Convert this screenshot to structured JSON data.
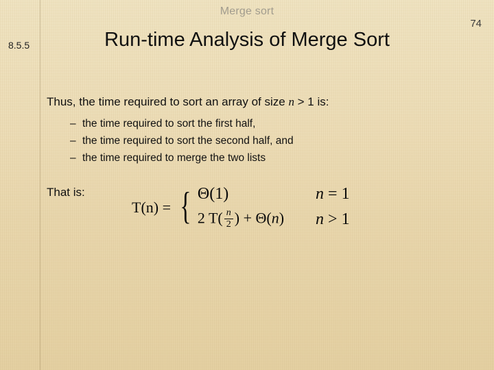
{
  "header": {
    "topic": "Merge sort"
  },
  "page_number": "74",
  "section_number": "8.5.5",
  "title": "Run-time Analysis of Merge Sort",
  "body": {
    "intro_pre": "Thus, the time required to sort an array of size ",
    "intro_var": "n",
    "intro_post": " > 1 is:",
    "bullets": [
      "the time required to sort the first half,",
      "the time required to sort the second half, and",
      "the time required to merge the two lists"
    ],
    "that_is": "That is:"
  },
  "formula": {
    "lhs": "T(n) =",
    "case1_expr": "Θ(1)",
    "case1_cond_var": "n",
    "case1_cond_rest": " = 1",
    "case2_prefix": "2 T(",
    "case2_frac_num": "n",
    "case2_frac_den": "2",
    "case2_mid": ") + Θ(",
    "case2_arg": "n",
    "case2_suffix": ")",
    "case2_cond_var": "n",
    "case2_cond_rest": " > 1"
  }
}
